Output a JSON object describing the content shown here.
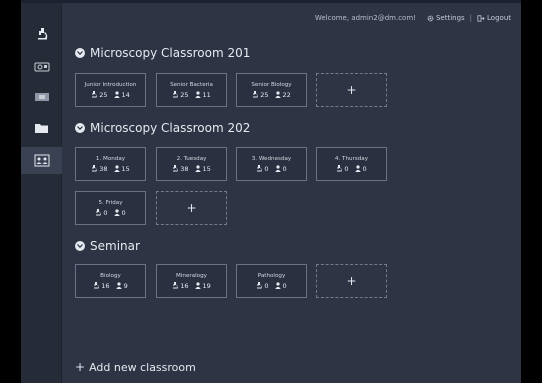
{
  "header": {
    "welcome": "Welcome, admin2@dm.com!",
    "settings_label": "Settings",
    "separator": "|",
    "logout_label": "Logout"
  },
  "sidebar": {
    "items": [
      {
        "icon": "microscope-icon",
        "active": false
      },
      {
        "icon": "camera-icon",
        "active": false
      },
      {
        "icon": "slide-icon",
        "active": false
      },
      {
        "icon": "folder-icon",
        "active": false
      },
      {
        "icon": "classroom-icon",
        "active": true
      }
    ]
  },
  "sections": [
    {
      "title": "Microscopy Classroom 201",
      "classes": [
        {
          "name": "Junior Introduction",
          "microscopes": "25",
          "students": "14"
        },
        {
          "name": "Senior Bacteria",
          "microscopes": "25",
          "students": "11"
        },
        {
          "name": "Senior Biology",
          "microscopes": "25",
          "students": "22"
        }
      ]
    },
    {
      "title": "Microscopy Classroom 202",
      "classes": [
        {
          "name": "1. Monday",
          "microscopes": "38",
          "students": "15"
        },
        {
          "name": "2. Tuesday",
          "microscopes": "38",
          "students": "15"
        },
        {
          "name": "3. Wednesday",
          "microscopes": "0",
          "students": "0"
        },
        {
          "name": "4. Thursday",
          "microscopes": "0",
          "students": "0"
        },
        {
          "name": "5. Friday",
          "microscopes": "0",
          "students": "0"
        }
      ]
    },
    {
      "title": "Seminar",
      "classes": [
        {
          "name": "Biology",
          "microscopes": "16",
          "students": "9"
        },
        {
          "name": "Mineralogy",
          "microscopes": "16",
          "students": "19"
        },
        {
          "name": "Pathology",
          "microscopes": "0",
          "students": "0"
        }
      ]
    }
  ],
  "add_card_symbol": "+",
  "add_classroom": {
    "symbol": "+",
    "label": "Add new classroom"
  }
}
